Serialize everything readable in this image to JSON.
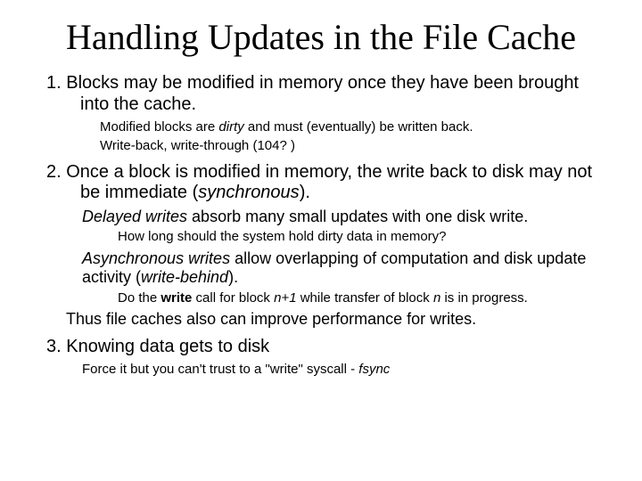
{
  "title": "Handling Updates in the File Cache",
  "item1": {
    "text_a": "1. Blocks may be modified in memory once they have been brought into the cache.",
    "sub_a": "Modified blocks are ",
    "sub_a_em": "dirty",
    "sub_a_tail": " and must (eventually) be written back.",
    "sub_b": "Write-back, write-through (104? )"
  },
  "item2": {
    "text_a": "2. Once a block is modified in memory, the write back to disk may not be immediate (",
    "text_a_em": "synchronous",
    "text_a_tail": ").",
    "delayed_a_em": "Delayed writes",
    "delayed_a_tail": " absorb many small updates with one disk write.",
    "delayed_q": "How long should the system hold dirty data in memory?",
    "async_a_em": "Asynchronous writes",
    "async_a_tail": " allow overlapping of computation and disk update activity (",
    "async_a_em2": "write-behind",
    "async_a_tail2": ").",
    "async_b_a": "Do the ",
    "async_b_em1": "write",
    "async_b_mid1": " call for block ",
    "async_b_em2": "n+1",
    "async_b_mid2": " while transfer of block ",
    "async_b_em3": "n",
    "async_b_tail": " is in progress.",
    "thus": "Thus file caches also can improve performance for writes."
  },
  "item3": {
    "text": "3. Knowing data gets to disk",
    "sub_a": "Force it but you can't trust to a \"write\" syscall - ",
    "sub_a_em": "fsync"
  }
}
